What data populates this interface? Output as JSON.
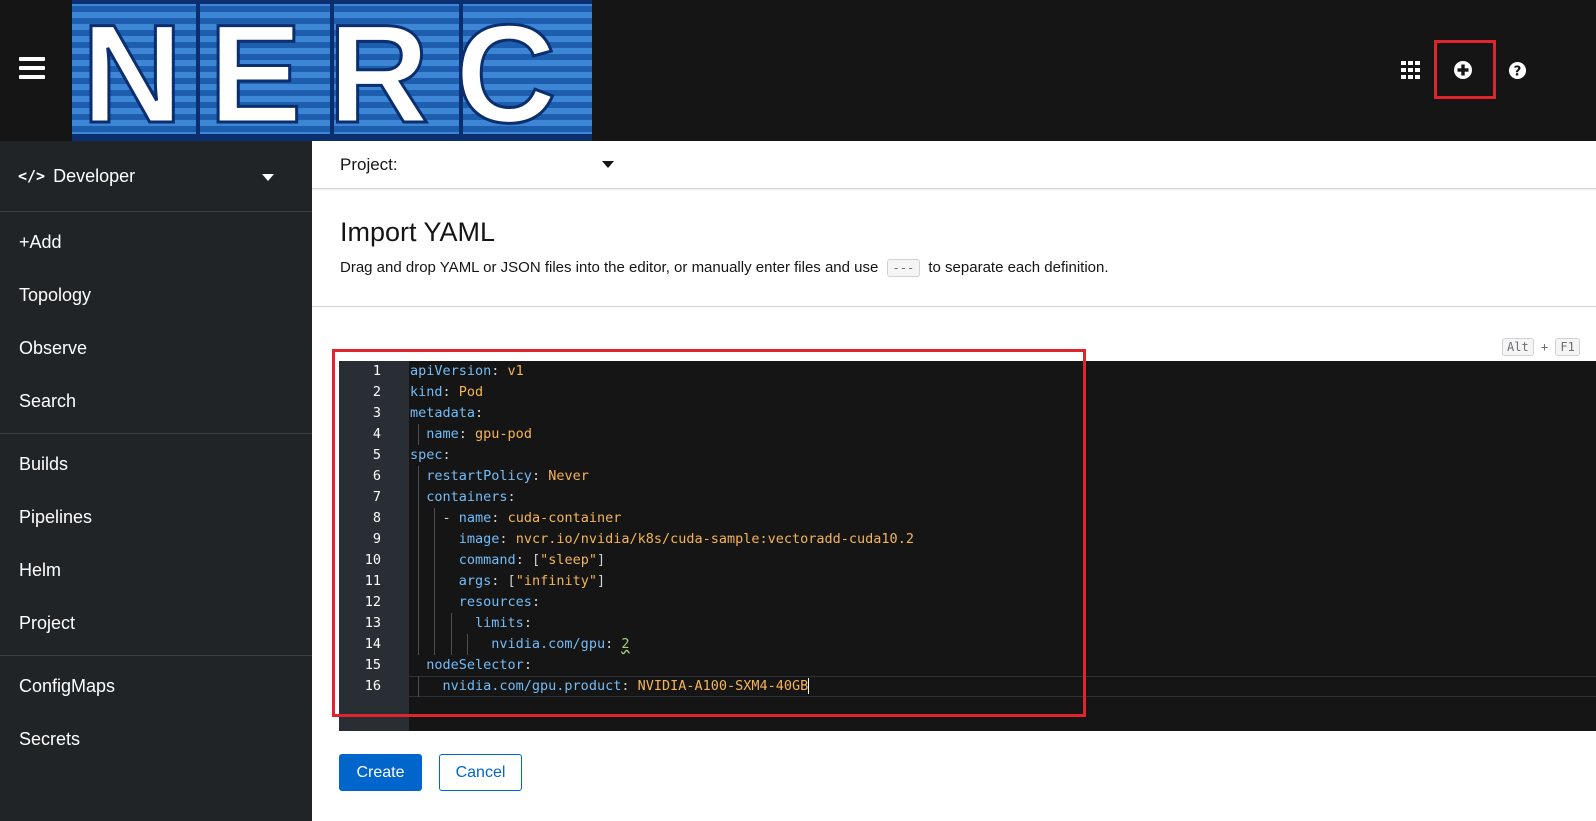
{
  "masthead": {
    "logo_text": "NERC",
    "icons": [
      "grid-icon",
      "plus-circle-icon",
      "help-icon"
    ]
  },
  "sidebar": {
    "perspective": {
      "label": "Developer",
      "icon": "code-icon"
    },
    "groups": [
      {
        "items": [
          {
            "label": "+Add"
          },
          {
            "label": "Topology"
          },
          {
            "label": "Observe"
          },
          {
            "label": "Search"
          }
        ]
      },
      {
        "items": [
          {
            "label": "Builds"
          },
          {
            "label": "Pipelines"
          },
          {
            "label": "Helm"
          },
          {
            "label": "Project"
          }
        ]
      },
      {
        "items": [
          {
            "label": "ConfigMaps"
          },
          {
            "label": "Secrets"
          }
        ]
      }
    ]
  },
  "project_bar": {
    "label": "Project:"
  },
  "page": {
    "title": "Import YAML",
    "description_before": "Drag and drop YAML or JSON files into the editor, or manually enter files and use",
    "separator_code": "---",
    "description_after": "to separate each definition."
  },
  "shortcut": {
    "key1": "Alt",
    "plus": "+",
    "key2": "F1"
  },
  "editor": {
    "lines": [
      {
        "num": "1",
        "key": "apiVersion",
        "colon": ": ",
        "value": "v1",
        "indent": ""
      },
      {
        "num": "2",
        "key": "kind",
        "colon": ": ",
        "value": "Pod",
        "indent": ""
      },
      {
        "num": "3",
        "key": "metadata",
        "colon": ":",
        "value": "",
        "indent": ""
      },
      {
        "num": "4",
        "key": "name",
        "colon": ": ",
        "value": "gpu-pod",
        "indent": "  "
      },
      {
        "num": "5",
        "key": "spec",
        "colon": ":",
        "value": "",
        "indent": ""
      },
      {
        "num": "6",
        "key": "restartPolicy",
        "colon": ": ",
        "value": "Never",
        "indent": "  "
      },
      {
        "num": "7",
        "key": "containers",
        "colon": ":",
        "value": "",
        "indent": "  "
      },
      {
        "num": "8",
        "key": "name",
        "colon": ": ",
        "value": "cuda-container",
        "indent": "    - "
      },
      {
        "num": "9",
        "key": "image",
        "colon": ": ",
        "value": "nvcr.io/nvidia/k8s/cuda-sample:vectoradd-cuda10.2",
        "indent": "      "
      },
      {
        "num": "10",
        "key": "command",
        "colon": ": [",
        "value": "\"sleep\"",
        "close": "]",
        "indent": "      "
      },
      {
        "num": "11",
        "key": "args",
        "colon": ": [",
        "value": "\"infinity\"",
        "close": "]",
        "indent": "      "
      },
      {
        "num": "12",
        "key": "resources",
        "colon": ":",
        "value": "",
        "indent": "      "
      },
      {
        "num": "13",
        "key": "limits",
        "colon": ":",
        "value": "",
        "indent": "        "
      },
      {
        "num": "14",
        "key": "nvidia.com/gpu",
        "colon": ": ",
        "value": "2",
        "numeric": true,
        "indent": "          "
      },
      {
        "num": "15",
        "key": "nodeSelector",
        "colon": ":",
        "value": "",
        "indent": "  "
      },
      {
        "num": "16",
        "key": "nvidia.com/gpu.product",
        "colon": ": ",
        "value": "NVIDIA-A100-SXM4-40GB",
        "indent": "    ",
        "cursor": true
      }
    ]
  },
  "buttons": {
    "create": "Create",
    "cancel": "Cancel"
  },
  "colors": {
    "accent": "#0066cc",
    "highlight": "#e0242b",
    "masthead": "#151515",
    "sidebar": "#212427"
  }
}
